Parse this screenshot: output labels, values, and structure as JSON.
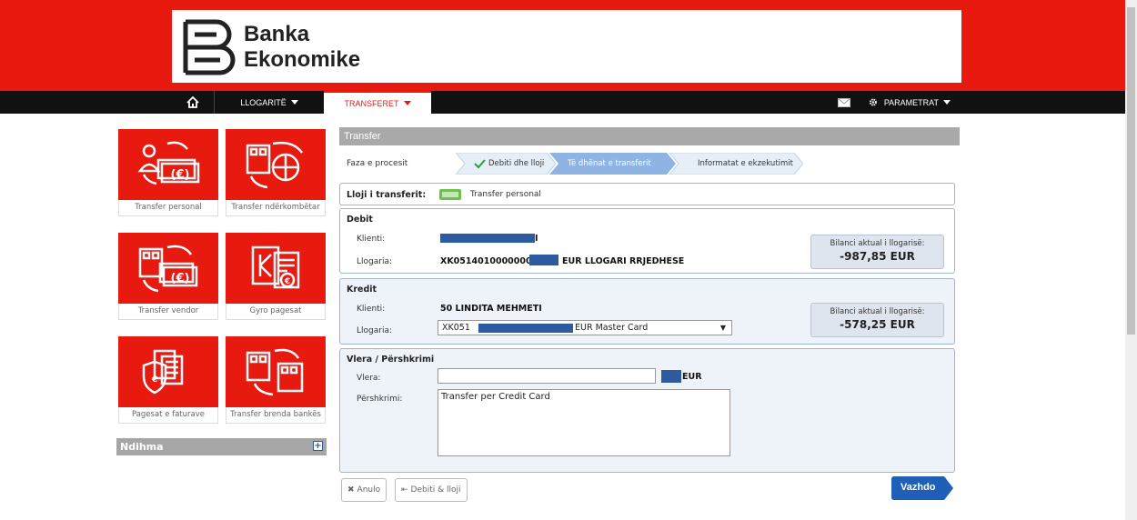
{
  "brand": {
    "line1": "Banka",
    "line2": "Ekonomike",
    "color": "#e8190f"
  },
  "nav": {
    "accounts_label": "LLOGARITË",
    "transfers_label": "TRANSFERET",
    "settings_label": "PARAMETRAT"
  },
  "tiles": [
    {
      "label": "Transfer personal",
      "icon": "personal-transfer-icon"
    },
    {
      "label": "Transfer ndërkombëtar",
      "icon": "international-transfer-icon"
    },
    {
      "label": "Transfer vendor",
      "icon": "domestic-transfer-icon"
    },
    {
      "label": "Gyro pagesat",
      "icon": "giro-payments-icon"
    },
    {
      "label": "Pagesat e faturave",
      "icon": "bill-payments-icon"
    },
    {
      "label": "Transfer brenda bankës",
      "icon": "internal-transfer-icon"
    }
  ],
  "help": {
    "label": "Ndihma"
  },
  "transfer": {
    "title": "Transfer",
    "process_label": "Faza e procesit",
    "steps": [
      "Debiti dhe lloji",
      "Të dhënat e transferit",
      "Informatat e ekzekutimit"
    ],
    "type_label": "Lloji i transferit:",
    "type_value": "Transfer personal",
    "debit": {
      "title": "Debit",
      "client_label": "Klienti:",
      "client_value_suffix": "I",
      "account_label": "Llogaria:",
      "account_value_prefix": "XK0514010000000",
      "account_value_suffix": "EUR LLOGARI RRJEDHESE",
      "balance_label": "Bilanci aktual i llogarisë:",
      "balance_value": "-987,85 EUR"
    },
    "credit": {
      "title": "Kredit",
      "client_label": "Klienti:",
      "client_value": "50 LINDITA MEHMETI",
      "account_label": "Llogaria:",
      "account_select_prefix": "XK051",
      "account_select_suffix": "EUR Master Card",
      "balance_label": "Bilanci aktual i llogarisë:",
      "balance_value": "-578,25 EUR"
    },
    "amount": {
      "title": "Vlera / Përshkrimi",
      "value_label": "Vlera:",
      "value": "",
      "currency": "EUR",
      "desc_label": "Përshkrimi:",
      "desc_value": "Transfer per Credit Card"
    },
    "buttons": {
      "cancel": "Anulo",
      "back": "Debiti & lloji",
      "next": "Vazhdo"
    }
  }
}
